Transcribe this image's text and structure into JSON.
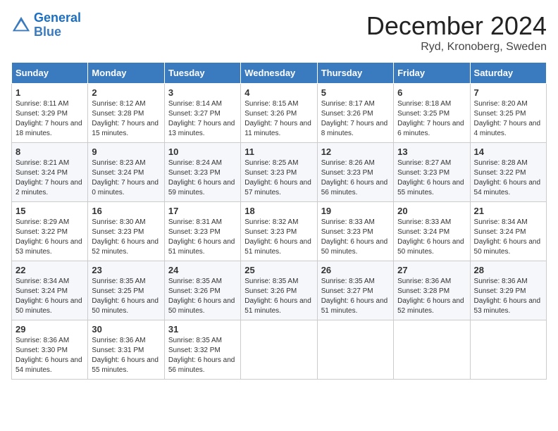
{
  "logo": {
    "line1": "General",
    "line2": "Blue"
  },
  "title": "December 2024",
  "location": "Ryd, Kronoberg, Sweden",
  "days_of_week": [
    "Sunday",
    "Monday",
    "Tuesday",
    "Wednesday",
    "Thursday",
    "Friday",
    "Saturday"
  ],
  "weeks": [
    [
      {
        "day": "1",
        "sunrise": "Sunrise: 8:11 AM",
        "sunset": "Sunset: 3:29 PM",
        "daylight": "Daylight: 7 hours and 18 minutes."
      },
      {
        "day": "2",
        "sunrise": "Sunrise: 8:12 AM",
        "sunset": "Sunset: 3:28 PM",
        "daylight": "Daylight: 7 hours and 15 minutes."
      },
      {
        "day": "3",
        "sunrise": "Sunrise: 8:14 AM",
        "sunset": "Sunset: 3:27 PM",
        "daylight": "Daylight: 7 hours and 13 minutes."
      },
      {
        "day": "4",
        "sunrise": "Sunrise: 8:15 AM",
        "sunset": "Sunset: 3:26 PM",
        "daylight": "Daylight: 7 hours and 11 minutes."
      },
      {
        "day": "5",
        "sunrise": "Sunrise: 8:17 AM",
        "sunset": "Sunset: 3:26 PM",
        "daylight": "Daylight: 7 hours and 8 minutes."
      },
      {
        "day": "6",
        "sunrise": "Sunrise: 8:18 AM",
        "sunset": "Sunset: 3:25 PM",
        "daylight": "Daylight: 7 hours and 6 minutes."
      },
      {
        "day": "7",
        "sunrise": "Sunrise: 8:20 AM",
        "sunset": "Sunset: 3:25 PM",
        "daylight": "Daylight: 7 hours and 4 minutes."
      }
    ],
    [
      {
        "day": "8",
        "sunrise": "Sunrise: 8:21 AM",
        "sunset": "Sunset: 3:24 PM",
        "daylight": "Daylight: 7 hours and 2 minutes."
      },
      {
        "day": "9",
        "sunrise": "Sunrise: 8:23 AM",
        "sunset": "Sunset: 3:24 PM",
        "daylight": "Daylight: 7 hours and 0 minutes."
      },
      {
        "day": "10",
        "sunrise": "Sunrise: 8:24 AM",
        "sunset": "Sunset: 3:23 PM",
        "daylight": "Daylight: 6 hours and 59 minutes."
      },
      {
        "day": "11",
        "sunrise": "Sunrise: 8:25 AM",
        "sunset": "Sunset: 3:23 PM",
        "daylight": "Daylight: 6 hours and 57 minutes."
      },
      {
        "day": "12",
        "sunrise": "Sunrise: 8:26 AM",
        "sunset": "Sunset: 3:23 PM",
        "daylight": "Daylight: 6 hours and 56 minutes."
      },
      {
        "day": "13",
        "sunrise": "Sunrise: 8:27 AM",
        "sunset": "Sunset: 3:23 PM",
        "daylight": "Daylight: 6 hours and 55 minutes."
      },
      {
        "day": "14",
        "sunrise": "Sunrise: 8:28 AM",
        "sunset": "Sunset: 3:22 PM",
        "daylight": "Daylight: 6 hours and 54 minutes."
      }
    ],
    [
      {
        "day": "15",
        "sunrise": "Sunrise: 8:29 AM",
        "sunset": "Sunset: 3:22 PM",
        "daylight": "Daylight: 6 hours and 53 minutes."
      },
      {
        "day": "16",
        "sunrise": "Sunrise: 8:30 AM",
        "sunset": "Sunset: 3:23 PM",
        "daylight": "Daylight: 6 hours and 52 minutes."
      },
      {
        "day": "17",
        "sunrise": "Sunrise: 8:31 AM",
        "sunset": "Sunset: 3:23 PM",
        "daylight": "Daylight: 6 hours and 51 minutes."
      },
      {
        "day": "18",
        "sunrise": "Sunrise: 8:32 AM",
        "sunset": "Sunset: 3:23 PM",
        "daylight": "Daylight: 6 hours and 51 minutes."
      },
      {
        "day": "19",
        "sunrise": "Sunrise: 8:33 AM",
        "sunset": "Sunset: 3:23 PM",
        "daylight": "Daylight: 6 hours and 50 minutes."
      },
      {
        "day": "20",
        "sunrise": "Sunrise: 8:33 AM",
        "sunset": "Sunset: 3:24 PM",
        "daylight": "Daylight: 6 hours and 50 minutes."
      },
      {
        "day": "21",
        "sunrise": "Sunrise: 8:34 AM",
        "sunset": "Sunset: 3:24 PM",
        "daylight": "Daylight: 6 hours and 50 minutes."
      }
    ],
    [
      {
        "day": "22",
        "sunrise": "Sunrise: 8:34 AM",
        "sunset": "Sunset: 3:24 PM",
        "daylight": "Daylight: 6 hours and 50 minutes."
      },
      {
        "day": "23",
        "sunrise": "Sunrise: 8:35 AM",
        "sunset": "Sunset: 3:25 PM",
        "daylight": "Daylight: 6 hours and 50 minutes."
      },
      {
        "day": "24",
        "sunrise": "Sunrise: 8:35 AM",
        "sunset": "Sunset: 3:26 PM",
        "daylight": "Daylight: 6 hours and 50 minutes."
      },
      {
        "day": "25",
        "sunrise": "Sunrise: 8:35 AM",
        "sunset": "Sunset: 3:26 PM",
        "daylight": "Daylight: 6 hours and 51 minutes."
      },
      {
        "day": "26",
        "sunrise": "Sunrise: 8:35 AM",
        "sunset": "Sunset: 3:27 PM",
        "daylight": "Daylight: 6 hours and 51 minutes."
      },
      {
        "day": "27",
        "sunrise": "Sunrise: 8:36 AM",
        "sunset": "Sunset: 3:28 PM",
        "daylight": "Daylight: 6 hours and 52 minutes."
      },
      {
        "day": "28",
        "sunrise": "Sunrise: 8:36 AM",
        "sunset": "Sunset: 3:29 PM",
        "daylight": "Daylight: 6 hours and 53 minutes."
      }
    ],
    [
      {
        "day": "29",
        "sunrise": "Sunrise: 8:36 AM",
        "sunset": "Sunset: 3:30 PM",
        "daylight": "Daylight: 6 hours and 54 minutes."
      },
      {
        "day": "30",
        "sunrise": "Sunrise: 8:36 AM",
        "sunset": "Sunset: 3:31 PM",
        "daylight": "Daylight: 6 hours and 55 minutes."
      },
      {
        "day": "31",
        "sunrise": "Sunrise: 8:35 AM",
        "sunset": "Sunset: 3:32 PM",
        "daylight": "Daylight: 6 hours and 56 minutes."
      },
      {
        "day": "",
        "sunrise": "",
        "sunset": "",
        "daylight": ""
      },
      {
        "day": "",
        "sunrise": "",
        "sunset": "",
        "daylight": ""
      },
      {
        "day": "",
        "sunrise": "",
        "sunset": "",
        "daylight": ""
      },
      {
        "day": "",
        "sunrise": "",
        "sunset": "",
        "daylight": ""
      }
    ]
  ]
}
